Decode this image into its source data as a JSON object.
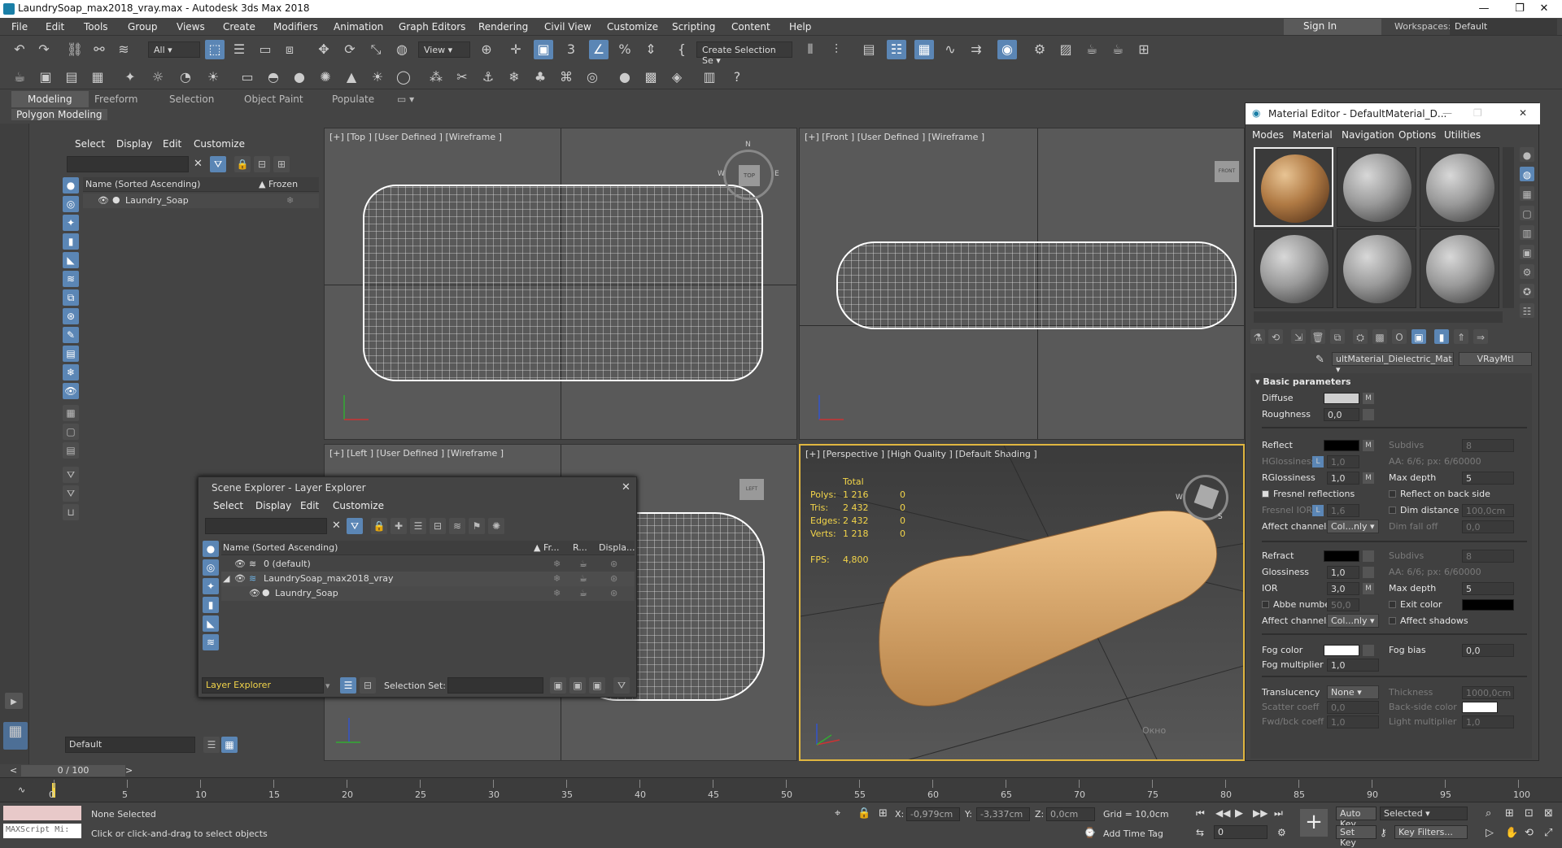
{
  "window": {
    "title": "LaundrySoap_max2018_vray.max - Autodesk 3ds Max 2018",
    "min": "—",
    "max": "❐",
    "close": "✕"
  },
  "menu": [
    "File",
    "Edit",
    "Tools",
    "Group",
    "Views",
    "Create",
    "Modifiers",
    "Animation",
    "Graph Editors",
    "Rendering",
    "Civil View",
    "Customize",
    "Scripting",
    "Content",
    "Help"
  ],
  "signin": "Sign In",
  "workspaces_label": "Workspaces:",
  "workspaces_value": "Default",
  "toolbar": {
    "filter": "All",
    "refcoord": "View",
    "selset": "Create Selection Se"
  },
  "ribbon_tabs": [
    "Modeling",
    "Freeform",
    "Selection",
    "Object Paint",
    "Populate"
  ],
  "ribbon_sub": "Polygon Modeling",
  "left_explorer": {
    "menu": [
      "Select",
      "Display",
      "Edit",
      "Customize"
    ],
    "col_name": "Name (Sorted Ascending)",
    "col_frozen": "Frozen",
    "rows": [
      "Laundry_Soap"
    ]
  },
  "viewports": {
    "top": "[+] [Top ] [User Defined ] [Wireframe ]",
    "front": "[+] [Front ] [User Defined ] [Wireframe ]",
    "left": "[+] [Left ] [User Defined ] [Wireframe ]",
    "persp": "[+] [Perspective ] [High Quality ] [Default Shading ]",
    "cube_top": "TOP",
    "cube_front": "FRONT",
    "cube_left": "LEFT",
    "compass": {
      "n": "N",
      "w": "W",
      "e": "E",
      "s": "S"
    }
  },
  "stats": {
    "header": "Total",
    "polys_label": "Polys:",
    "polys": "1 216",
    "polys_sel": "0",
    "tris_label": "Tris:",
    "tris": "2 432",
    "tris_sel": "0",
    "edges_label": "Edges:",
    "edges": "2 432",
    "edges_sel": "0",
    "verts_label": "Verts:",
    "verts": "1 218",
    "verts_sel": "0",
    "fps_label": "FPS:",
    "fps": "4,800"
  },
  "scene_explorer": {
    "title": "Scene Explorer - Layer Explorer",
    "menu": [
      "Select",
      "Display",
      "Edit",
      "Customize"
    ],
    "cols": [
      "Name (Sorted Ascending)",
      "Fr...",
      "R...",
      "Displa..."
    ],
    "rows": [
      "0 (default)",
      "LaundrySoap_max2018_vray",
      "Laundry_Soap"
    ],
    "footer_explorer": "Layer Explorer",
    "footer_selset": "Selection Set:"
  },
  "material_editor": {
    "title": "Material Editor - DefaultMaterial_D...",
    "menu": [
      "Modes",
      "Material",
      "Navigation",
      "Options",
      "Utilities"
    ],
    "mat_name": "ultMaterial_Dielectric_Mat",
    "mat_type": "VRayMtl",
    "rollout": "Basic parameters",
    "diffuse": "Diffuse",
    "roughness": "Roughness",
    "roughness_val": "0,0",
    "reflect": "Reflect",
    "subdivs": "Subdivs",
    "subdivs_val": "8",
    "hgloss": "HGlossiness",
    "hgloss_val": "1,0",
    "aa": "AA: 6/6; px: 6/60000",
    "rgloss": "RGlossiness",
    "rgloss_val": "1,0",
    "maxdepth": "Max depth",
    "maxdepth_val": "5",
    "fresnel": "Fresnel reflections",
    "reflect_back": "Reflect on back side",
    "fresnel_ior": "Fresnel IOR",
    "fresnel_ior_val": "1,6",
    "dim_dist": "Dim distance",
    "dim_dist_val": "100,0cm",
    "affect_ch": "Affect channels",
    "affect_ch_val": "Col...nly",
    "dim_falloff": "Dim fall off",
    "dim_falloff_val": "0,0",
    "refract": "Refract",
    "r_subdivs_val": "8",
    "glossiness": "Glossiness",
    "glossiness_val": "1,0",
    "ior": "IOR",
    "ior_val": "3,0",
    "r_maxdepth_val": "5",
    "abbe": "Abbe number",
    "abbe_val": "50,0",
    "exit_color": "Exit color",
    "r_affect_ch_val": "Col...nly",
    "affect_shadows": "Affect shadows",
    "fog_color": "Fog color",
    "fog_bias": "Fog bias",
    "fog_bias_val": "0,0",
    "fog_mult": "Fog multiplier",
    "fog_mult_val": "1,0",
    "translucency": "Translucency",
    "translucency_val": "None",
    "thickness": "Thickness",
    "thickness_val": "1000,0cm",
    "scatter": "Scatter coeff",
    "scatter_val": "0,0",
    "backside": "Back-side color",
    "fwdbck": "Fwd/bck coeff",
    "fwdbck_val": "1,0",
    "light_mult": "Light multiplier",
    "light_mult_val": "1,0",
    "m_label": "M",
    "ghost_tag": "Окно"
  },
  "layer_default": "Default",
  "time": {
    "slider": "0 / 100",
    "ticks": [
      "0",
      "5",
      "10",
      "15",
      "20",
      "25",
      "30",
      "35",
      "40",
      "45",
      "50",
      "55",
      "60",
      "65",
      "70",
      "75",
      "80",
      "85",
      "90",
      "95",
      "100"
    ]
  },
  "status": {
    "maxscript": "MAXScript Mi:",
    "none_selected": "None Selected",
    "prompt": "Click or click-and-drag to select objects",
    "x_label": "X:",
    "x_val": "-0,979cm",
    "y_label": "Y:",
    "y_val": "-3,337cm",
    "z_label": "Z:",
    "z_val": "0,0cm",
    "grid": "Grid = 10,0cm",
    "add_time_tag": "Add Time Tag",
    "autokey": "Auto Key",
    "setkey": "Set Key",
    "selected": "Selected",
    "keyfilters": "Key Filters...",
    "frame": "0"
  },
  "colors": {
    "accent": "#5b86b5",
    "persp_border": "#e0b640",
    "stats": "#f3d54a",
    "soap": "#d9a868"
  }
}
